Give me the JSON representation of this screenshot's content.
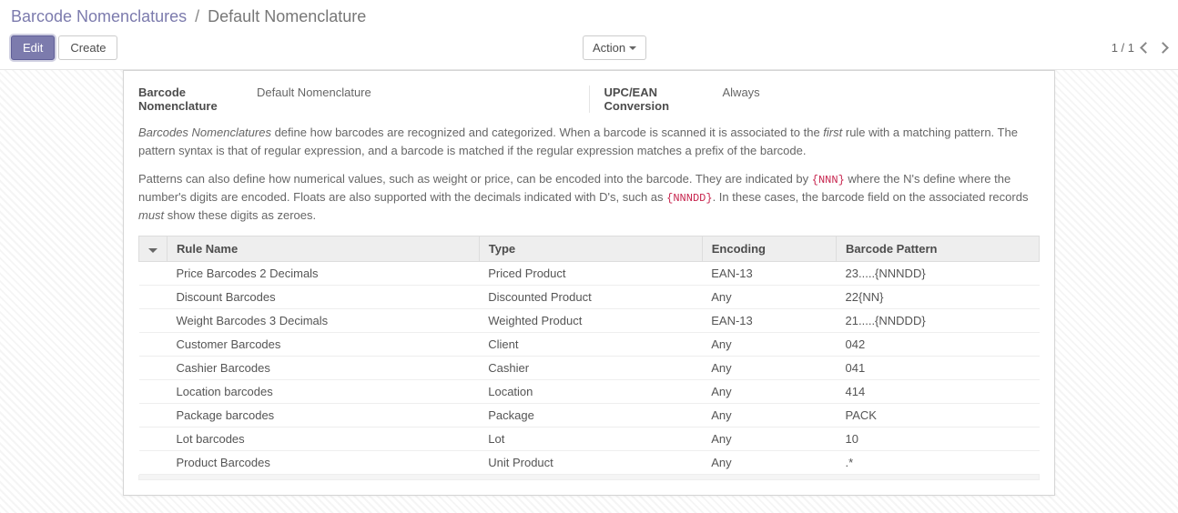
{
  "breadcrumb": {
    "parent": "Barcode Nomenclatures",
    "sep": "/",
    "current": "Default Nomenclature"
  },
  "toolbar": {
    "edit": "Edit",
    "create": "Create",
    "action": "Action",
    "pager": "1 / 1"
  },
  "form": {
    "name_label": "Barcode Nomenclature",
    "name_value": "Default Nomenclature",
    "conv_label": "UPC/EAN Conversion",
    "conv_value": "Always"
  },
  "desc": {
    "p1_a": "Barcodes Nomenclatures",
    "p1_b": " define how barcodes are recognized and categorized. When a barcode is scanned it is associated to the ",
    "p1_c": "first",
    "p1_d": " rule with a matching pattern. The pattern syntax is that of regular expression, and a barcode is matched if the regular expression matches a prefix of the barcode.",
    "p2_a": "Patterns can also define how numerical values, such as weight or price, can be encoded into the barcode. They are indicated by ",
    "p2_code1": "{NNN}",
    "p2_b": " where the N's define where the number's digits are encoded. Floats are also supported with the decimals indicated with D's, such as ",
    "p2_code2": "{NNNDD}",
    "p2_c": ". In these cases, the barcode field on the associated records ",
    "p2_d": "must",
    "p2_e": " show these digits as zeroes."
  },
  "table": {
    "headers": {
      "rule": "Rule Name",
      "type": "Type",
      "encoding": "Encoding",
      "pattern": "Barcode Pattern"
    },
    "rows": [
      {
        "rule": "Price Barcodes 2 Decimals",
        "type": "Priced Product",
        "encoding": "EAN-13",
        "pattern": "23.....{NNNDD}"
      },
      {
        "rule": "Discount Barcodes",
        "type": "Discounted Product",
        "encoding": "Any",
        "pattern": "22{NN}"
      },
      {
        "rule": "Weight Barcodes 3 Decimals",
        "type": "Weighted Product",
        "encoding": "EAN-13",
        "pattern": "21.....{NNDDD}"
      },
      {
        "rule": "Customer Barcodes",
        "type": "Client",
        "encoding": "Any",
        "pattern": "042"
      },
      {
        "rule": "Cashier Barcodes",
        "type": "Cashier",
        "encoding": "Any",
        "pattern": "041"
      },
      {
        "rule": "Location barcodes",
        "type": "Location",
        "encoding": "Any",
        "pattern": "414"
      },
      {
        "rule": "Package barcodes",
        "type": "Package",
        "encoding": "Any",
        "pattern": "PACK"
      },
      {
        "rule": "Lot barcodes",
        "type": "Lot",
        "encoding": "Any",
        "pattern": "10"
      },
      {
        "rule": "Product Barcodes",
        "type": "Unit Product",
        "encoding": "Any",
        "pattern": ".*"
      }
    ]
  }
}
